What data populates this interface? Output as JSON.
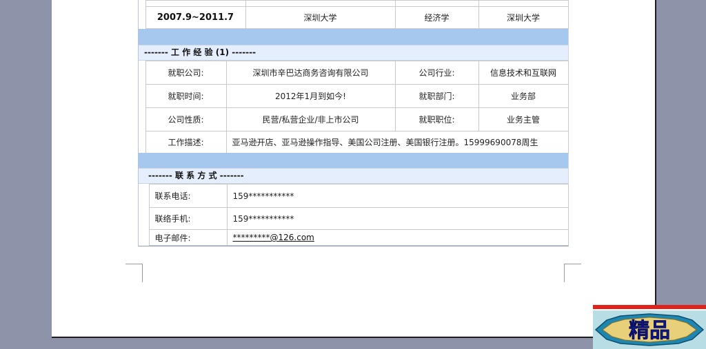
{
  "education": {
    "period": "2007.9~2011.7",
    "school": "深圳大学",
    "major": "经济学",
    "location": "深圳大学"
  },
  "work": {
    "section_title": "------- 工 作 经 验 (1) -------",
    "rows": [
      {
        "label1": "就职公司:",
        "value1": "深圳市辛巴达商务咨询有限公司",
        "label2": "公司行业:",
        "value2": "信息技术和互联网"
      },
      {
        "label1": "就职时间:",
        "value1": "2012年1月到如今!",
        "label2": "就职部门:",
        "value2": "业务部"
      },
      {
        "label1": "公司性质:",
        "value1": "民营/私营企业/非上市公司",
        "label2": "就职职位:",
        "value2": "业务主管"
      }
    ],
    "description_label": "工作描述:",
    "description_value": "亚马逊开店、亚马逊操作指导、美国公司注册、美国银行注册。15999690078周生"
  },
  "contact": {
    "section_title": "------- 联 系 方 式 -------",
    "rows": [
      {
        "label": "联系电话:",
        "value": "159***********"
      },
      {
        "label": "联络手机:",
        "value": "159***********"
      },
      {
        "label": "电子邮件:",
        "value": "*********@126.com"
      }
    ]
  },
  "badge": {
    "text": "精品",
    "colors": {
      "stripe": "#e0241b",
      "frame": "#1f86b0",
      "fill": "#e8d07a",
      "text": "#1226c8"
    }
  },
  "colors": {
    "background": "#8d93a8",
    "page": "#ffffff",
    "blue_band": "#a6c8ef",
    "light_band": "#e4eefc"
  }
}
